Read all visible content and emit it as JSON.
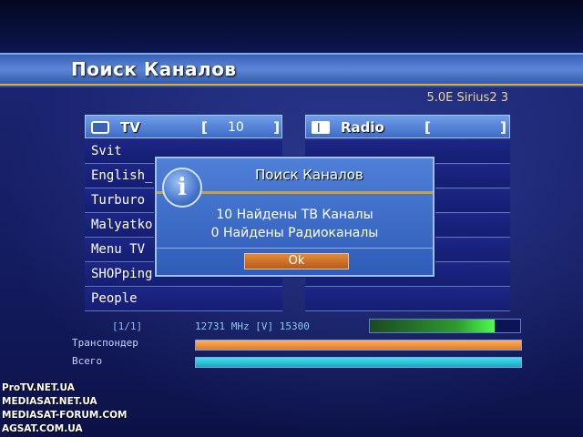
{
  "screen": {
    "title": "Поиск Каналов",
    "satellite": "5.0E Sirius2 3"
  },
  "tv_list": {
    "header_label": "TV",
    "bracket_left": "[",
    "bracket_right": "]",
    "count": "10",
    "icon": "tv-icon",
    "items": [
      "Svit",
      "English_",
      "Turburo",
      "Malyatko",
      "Menu TV",
      "SHOPping",
      "People"
    ]
  },
  "radio_list": {
    "header_label": "Radio",
    "bracket_left": "[",
    "bracket_right": "]",
    "icon": "radio-icon",
    "items": [
      "",
      "",
      "",
      "",
      "",
      "",
      ""
    ]
  },
  "dialog": {
    "title": "Поиск Каналов",
    "icon": "info-icon",
    "icon_glyph": "i",
    "message_tv": "10 Найдены ТВ Каналы",
    "message_radio": "0 Найдены Радиоканалы",
    "ok_label": "Ok"
  },
  "status": {
    "page": "[1/1]",
    "transponder_info": "12731 MHz [V] 15300",
    "signal_level_percent": 83,
    "transponder_label": "Транспондер",
    "transponder_progress_percent": 100,
    "total_label": "Всего",
    "total_progress_percent": 100
  },
  "watermarks": [
    "ProTV.NET.UA",
    "MEDIASAT.NET.UA",
    "MEDIASAT-FORUM.COM",
    "AGSAT.COM.UA"
  ],
  "colors": {
    "title_bar": "#4a76cc",
    "accent_gold": "#d8b040",
    "ok_button": "#c86a28",
    "transponder_bar": "#e88a30",
    "total_bar": "#28c0d8",
    "signal_bar": "#3ccc3c"
  }
}
